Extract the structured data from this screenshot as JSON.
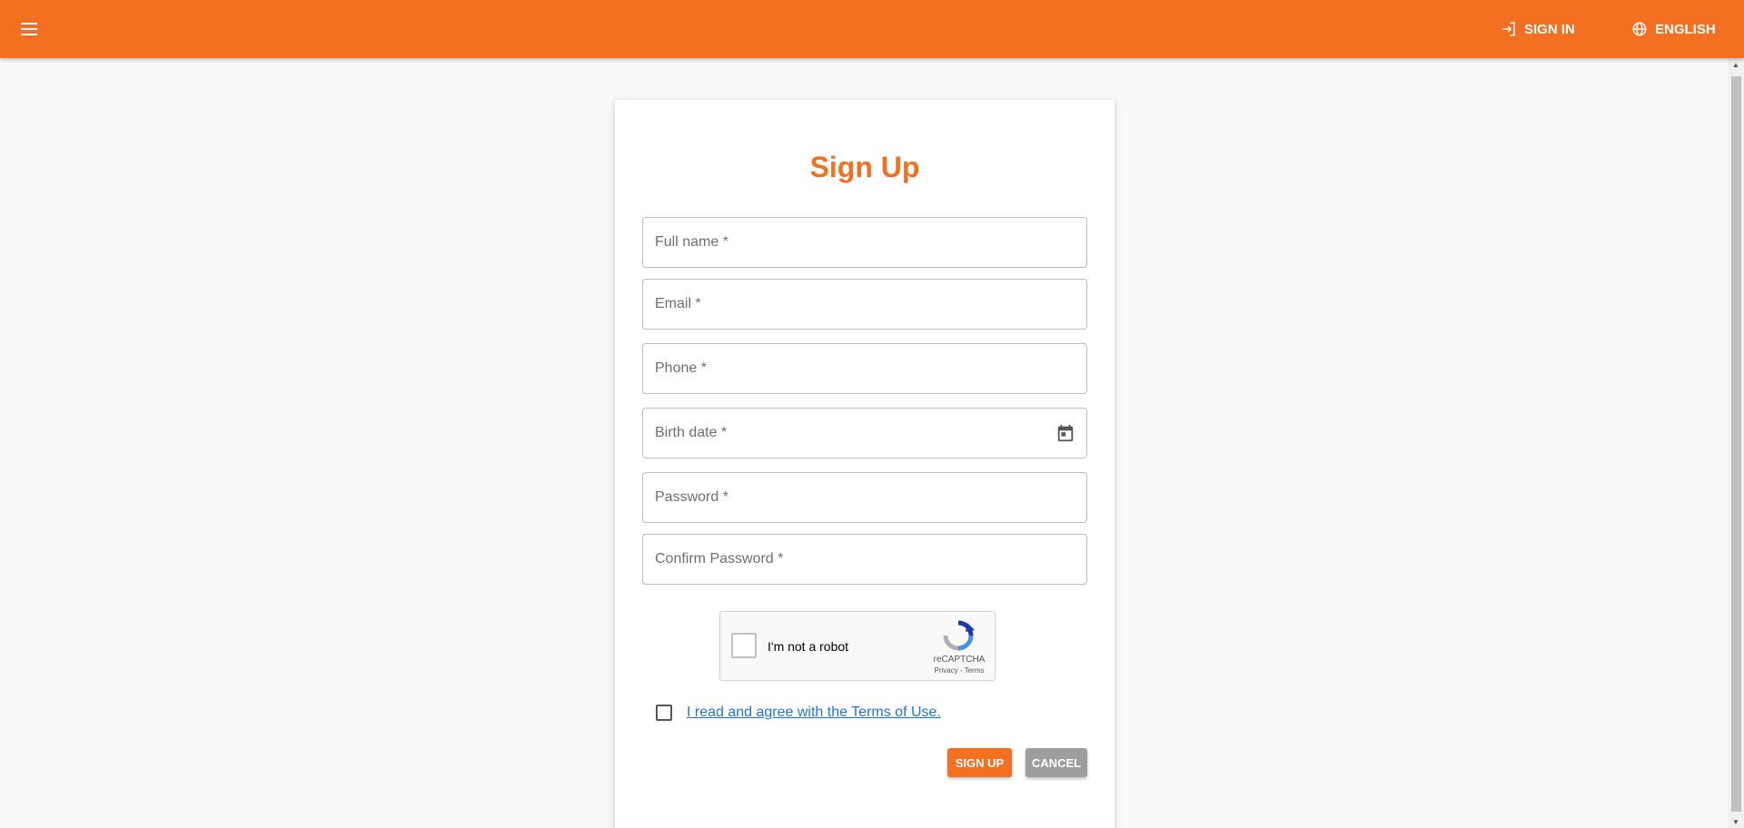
{
  "header": {
    "menu_icon": "hamburger-menu-icon",
    "signin_label": "SIGN IN",
    "signin_icon": "login-icon",
    "language_label": "ENGLISH",
    "language_icon": "globe-icon",
    "brand_color": "#f37021"
  },
  "form": {
    "title": "Sign Up",
    "fields": {
      "full_name": "Full name *",
      "email": "Email *",
      "phone": "Phone *",
      "birth_date": "Birth date *",
      "password": "Password *",
      "confirm_password": "Confirm Password *"
    },
    "birth_date_icon": "calendar-icon",
    "recaptcha": {
      "label": "I'm not a robot",
      "brand": "reCAPTCHA",
      "links": "Privacy - Terms"
    },
    "terms_text": "I read and agree with the Terms of Use.",
    "signup_label": "SIGN UP",
    "cancel_label": "CANCEL",
    "cancel_color": "#9e9e9e",
    "link_color": "#1e74d6"
  }
}
